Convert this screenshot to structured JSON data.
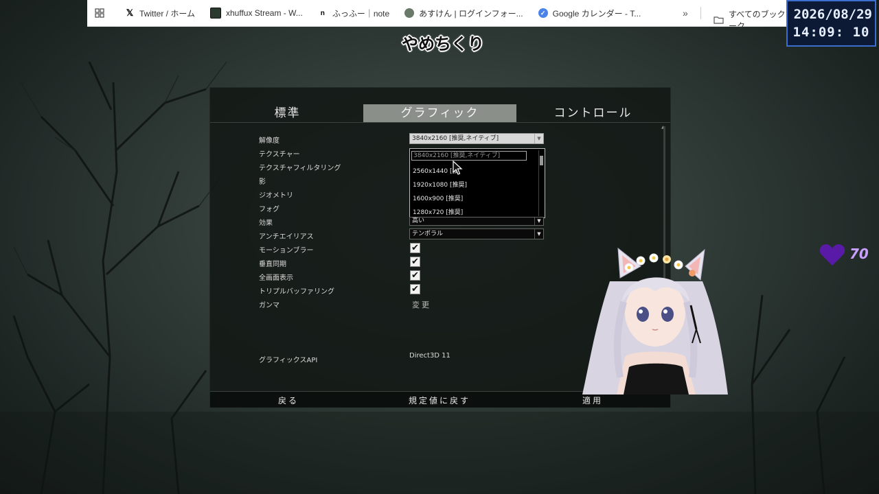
{
  "browser": {
    "bookmarks": [
      {
        "label": "Twitter / ホーム",
        "icon": "x-logo-icon",
        "color": "#000000"
      },
      {
        "label": "xhuffux Stream - W...",
        "icon": "stream-favicon-icon",
        "color": "#2b3a2f"
      },
      {
        "label": "ふっふー｜note",
        "icon": "note-logo-icon",
        "color": "#000000"
      },
      {
        "label": "あすけん | ログインフォー...",
        "icon": "asken-favicon-icon",
        "color": "#6a7a6a"
      },
      {
        "label": "Google カレンダー - T...",
        "icon": "google-calendar-icon",
        "color": "#4a84e8"
      }
    ],
    "more_label": "»",
    "all_bookmarks_label": "すべてのブックマーク"
  },
  "clock": {
    "date": "2026/08/29",
    "time": "14:09: 10"
  },
  "caption": "やめちくり",
  "settings": {
    "tabs": [
      {
        "label": "標準",
        "active": false
      },
      {
        "label": "グラフィック",
        "active": true
      },
      {
        "label": "コントロール",
        "active": false
      }
    ],
    "labels": {
      "resolution": "解像度",
      "texture": "テクスチャー",
      "texture_filtering": "テクスチャフィルタリング",
      "shadow": "影",
      "geometry": "ジオメトリ",
      "fog": "フォグ",
      "effects": "効果",
      "antialias": "アンチエイリアス",
      "motion_blur": "モーションブラー",
      "vsync": "垂直同期",
      "fullscreen": "全画面表示",
      "triple_buffering": "トリプルバッファリング",
      "gamma": "ガンマ",
      "graphics_api": "グラフィックスAPI"
    },
    "resolution_value": "3840x2160 [推奨,ネイティブ]",
    "resolution_options": [
      "3840x2160 [推奨,ネイティブ]",
      "2560x1440 [推",
      "1920x1080 [推奨]",
      "1600x900 [推奨]",
      "1280x720 [推奨]"
    ],
    "effects_value": "高い",
    "antialias_value": "テンポラル",
    "check_mark": "✔",
    "motion_blur_checked": true,
    "vsync_checked": true,
    "fullscreen_checked": true,
    "triple_buffering_checked": true,
    "gamma_action": "変更",
    "graphics_api_value": "Direct3D 11",
    "footer": {
      "back": "戻る",
      "reset": "規定値に戻す",
      "apply": "適用"
    }
  },
  "overlay": {
    "heart_count": "70",
    "heart_color": "#5a1aa8"
  }
}
